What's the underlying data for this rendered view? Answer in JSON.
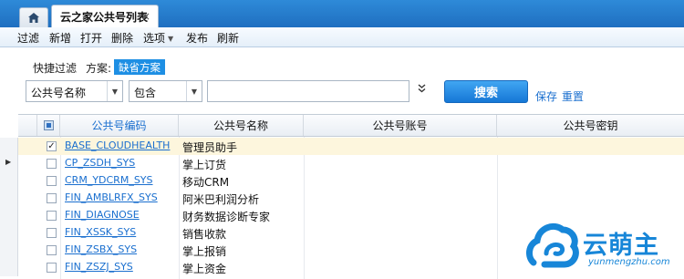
{
  "tabs": {
    "home_icon": "home-icon",
    "active_label": "云之家公共号列表",
    "close_glyph": "×"
  },
  "toolbar": {
    "items": [
      "过滤",
      "新增",
      "打开",
      "删除",
      "选项",
      "发布",
      "刷新"
    ],
    "options_arrow": "▼"
  },
  "filter": {
    "quick_filter_label": "快捷过滤",
    "scheme_label": "方案:",
    "scheme_value": "缺省方案",
    "field_select": "公共号名称",
    "operator_select": "包含",
    "value_input": "",
    "expand_glyph": "»",
    "search_button": "搜索",
    "save_link": "保存",
    "reset_link": "重置"
  },
  "grid": {
    "columns": [
      "公共号编码",
      "公共号名称",
      "公共号账号",
      "公共号密钥"
    ],
    "rows": [
      {
        "code": "BASE_CLOUDHEALTH",
        "name": "管理员助手",
        "checked": true,
        "current": false
      },
      {
        "code": "CP_ZSDH_SYS",
        "name": "掌上订货",
        "checked": false,
        "current": true
      },
      {
        "code": "CRM_YDCRM_SYS",
        "name": "移动CRM",
        "checked": false,
        "current": false
      },
      {
        "code": "FIN_AMBLRFX_SYS",
        "name": "阿米巴利润分析",
        "checked": false,
        "current": false
      },
      {
        "code": "FIN_DIAGNOSE",
        "name": "财务数据诊断专家",
        "checked": false,
        "current": false
      },
      {
        "code": "FIN_XSSK_SYS",
        "name": "销售收款",
        "checked": false,
        "current": false
      },
      {
        "code": "FIN_ZSBX_SYS",
        "name": "掌上报销",
        "checked": false,
        "current": false
      },
      {
        "code": "FIN_ZSZJ_SYS",
        "name": "掌上资金",
        "checked": false,
        "current": false
      }
    ]
  },
  "watermark": {
    "text": "云萌主",
    "url": "yunmengzhu.com"
  },
  "colors": {
    "accent": "#1e8fe4",
    "tabbar": "#2e8ad8",
    "link": "#1a6fcf",
    "selected_row": "#fdf6dd"
  }
}
